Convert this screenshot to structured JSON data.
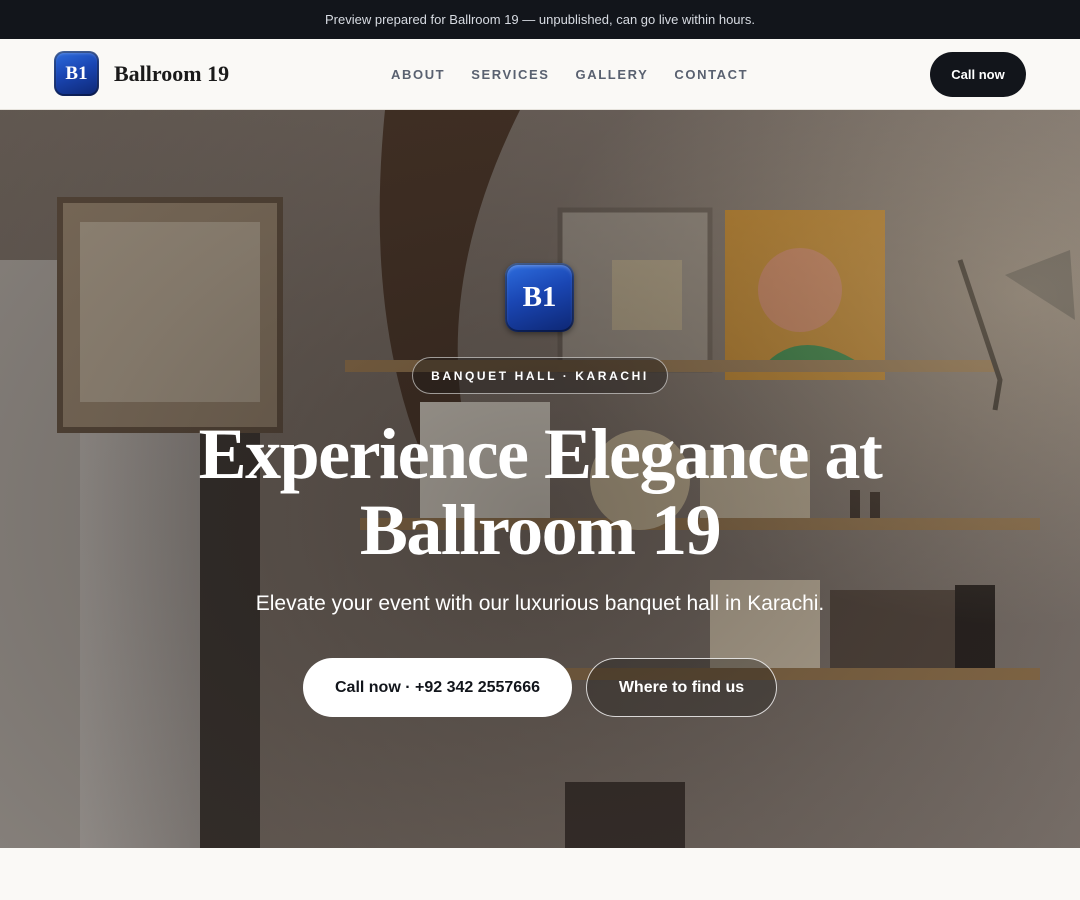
{
  "preview_bar": {
    "text": "Preview prepared for Ballroom 19 — unpublished, can go live within hours."
  },
  "header": {
    "logo_text": "B1",
    "brand_name": "Ballroom 19",
    "nav": [
      {
        "label": "ABOUT"
      },
      {
        "label": "SERVICES"
      },
      {
        "label": "GALLERY"
      },
      {
        "label": "CONTACT"
      }
    ],
    "cta_label": "Call now"
  },
  "hero": {
    "logo_text": "B1",
    "eyebrow": "BANQUET HALL · KARACHI",
    "headline_line1": "Experience Elegance at",
    "headline_line2": "Ballroom 19",
    "subheadline": "Elevate your event with our luxurious banquet hall in Karachi.",
    "primary_button": "Call now · +92 342 2557666",
    "secondary_button": "Where to find us",
    "background_image": "cafe-shelves-photo"
  },
  "colors": {
    "top_bar": "#12151b",
    "page_background": "#faf9f6",
    "nav_link": "#596170",
    "badge_blue": "#1a46b3",
    "cta_dark": "#12151b"
  }
}
